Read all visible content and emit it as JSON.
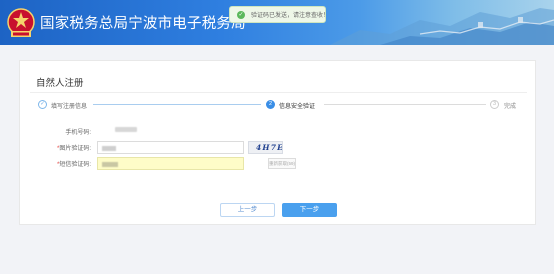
{
  "header": {
    "site_title": "国家税务总局宁波市电子税务局",
    "logo_text": "中国税务"
  },
  "toast": {
    "message": "验证码已发送，请注意查收！",
    "icon": "check-circle-icon"
  },
  "page": {
    "title": "自然人注册"
  },
  "steps": [
    {
      "number": "1",
      "label": "填写注册信息",
      "state": "done"
    },
    {
      "number": "2",
      "label": "信息安全验证",
      "state": "active"
    },
    {
      "number": "3",
      "label": "完成",
      "state": "pending"
    }
  ],
  "form": {
    "phone_label": "手机号码:",
    "image_code_label": "图片验证码:",
    "sms_code_label": "短信验证码:",
    "required_mark": "*",
    "captcha_text": "4H7E",
    "resend_label": "重新获取(59)"
  },
  "buttons": {
    "prev": "上一步",
    "next": "下一步"
  },
  "colors": {
    "accent": "#3a8ee6",
    "header_start": "#1d63c4",
    "required": "#e64340"
  }
}
